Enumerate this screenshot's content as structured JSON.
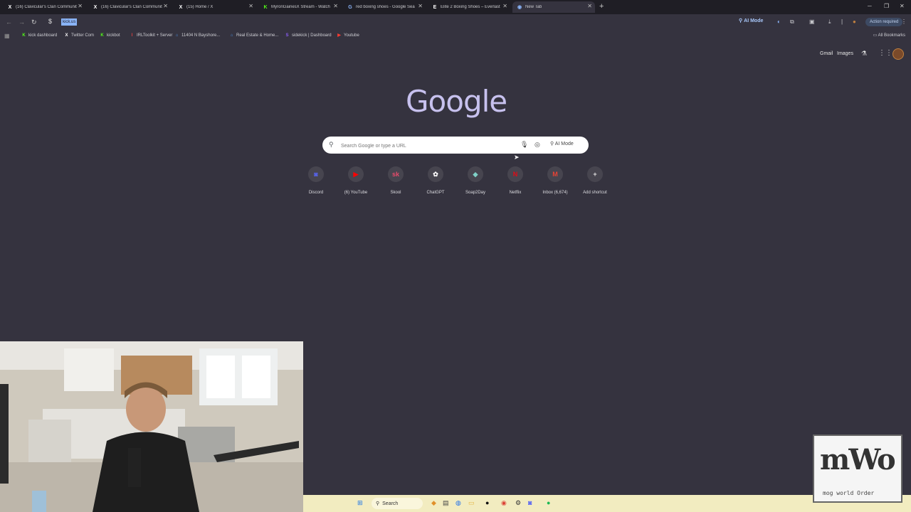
{
  "tabs": [
    {
      "title": "(16) Clavicular's Clan Communit",
      "icon": "x-logo-icon",
      "glyph": "X",
      "color": "#ffffff"
    },
    {
      "title": "(16) Clavicular's Clan Communit",
      "icon": "x-logo-icon",
      "glyph": "X",
      "color": "#ffffff"
    },
    {
      "title": "(15) Home / X",
      "icon": "x-logo-icon",
      "glyph": "X",
      "color": "#ffffff"
    },
    {
      "title": "MyronGainesX Stream - Watch",
      "icon": "kick-icon",
      "glyph": "K",
      "color": "#53fc18"
    },
    {
      "title": "red boxing shoes - Google Sea",
      "icon": "google-icon",
      "glyph": "G",
      "color": "#8ab4f8"
    },
    {
      "title": "Elite 2 Boxing Shoes – Everlast",
      "icon": "everlast-icon",
      "glyph": "E",
      "color": "#ffffff"
    },
    {
      "title": "New Tab",
      "icon": "chrome-icon",
      "glyph": "◉",
      "color": "#8ab4f8"
    }
  ],
  "toolbar": {
    "omnibox_selected": "kick.us",
    "ai_mode": "AI Mode",
    "action_required": "Action required"
  },
  "bookmarks": [
    {
      "label": "kick dashboard",
      "glyph": "K",
      "color": "#53fc18"
    },
    {
      "label": "Twitter Com",
      "glyph": "X",
      "color": "#ffffff"
    },
    {
      "label": "kickbot",
      "glyph": "K",
      "color": "#53fc18"
    },
    {
      "label": "IRLToolkit + Server",
      "glyph": "I",
      "color": "#e04040"
    },
    {
      "label": "11404 N Bayshore...",
      "glyph": "⌂",
      "color": "#4a90e2"
    },
    {
      "label": "Real Estate & Home...",
      "glyph": "⌂",
      "color": "#4a90e2"
    },
    {
      "label": "sidekick | Dashboard",
      "glyph": "S",
      "color": "#8a5cf5"
    },
    {
      "label": "Youtube",
      "glyph": "▶",
      "color": "#ff3b30"
    }
  ],
  "all_bookmarks": "All Bookmarks",
  "page_links": {
    "gmail": "Gmail",
    "images": "Images"
  },
  "logo": "Google",
  "search": {
    "placeholder": "Search Google or type a URL",
    "ai_mode": "AI Mode"
  },
  "shortcuts": [
    {
      "label": "Discord",
      "glyph": "◙",
      "color": "#5865f2"
    },
    {
      "label": "(6) YouTube",
      "glyph": "▶",
      "color": "#ff0000"
    },
    {
      "label": "Skool",
      "glyph": "sk",
      "color": "#e94b6b"
    },
    {
      "label": "ChatGPT",
      "glyph": "✿",
      "color": "#ffffff"
    },
    {
      "label": "Soap2Day",
      "glyph": "◆",
      "color": "#7fd1c7"
    },
    {
      "label": "Netflix",
      "glyph": "N",
      "color": "#e50914"
    },
    {
      "label": "Inbox (6,674)",
      "glyph": "M",
      "color": "#ea4335"
    },
    {
      "label": "Add shortcut",
      "glyph": "+",
      "color": "#e3e3e3"
    }
  ],
  "taskbar": {
    "search": "Search"
  },
  "overlay_logo": {
    "big": "mWo",
    "small": "mog world Order"
  }
}
